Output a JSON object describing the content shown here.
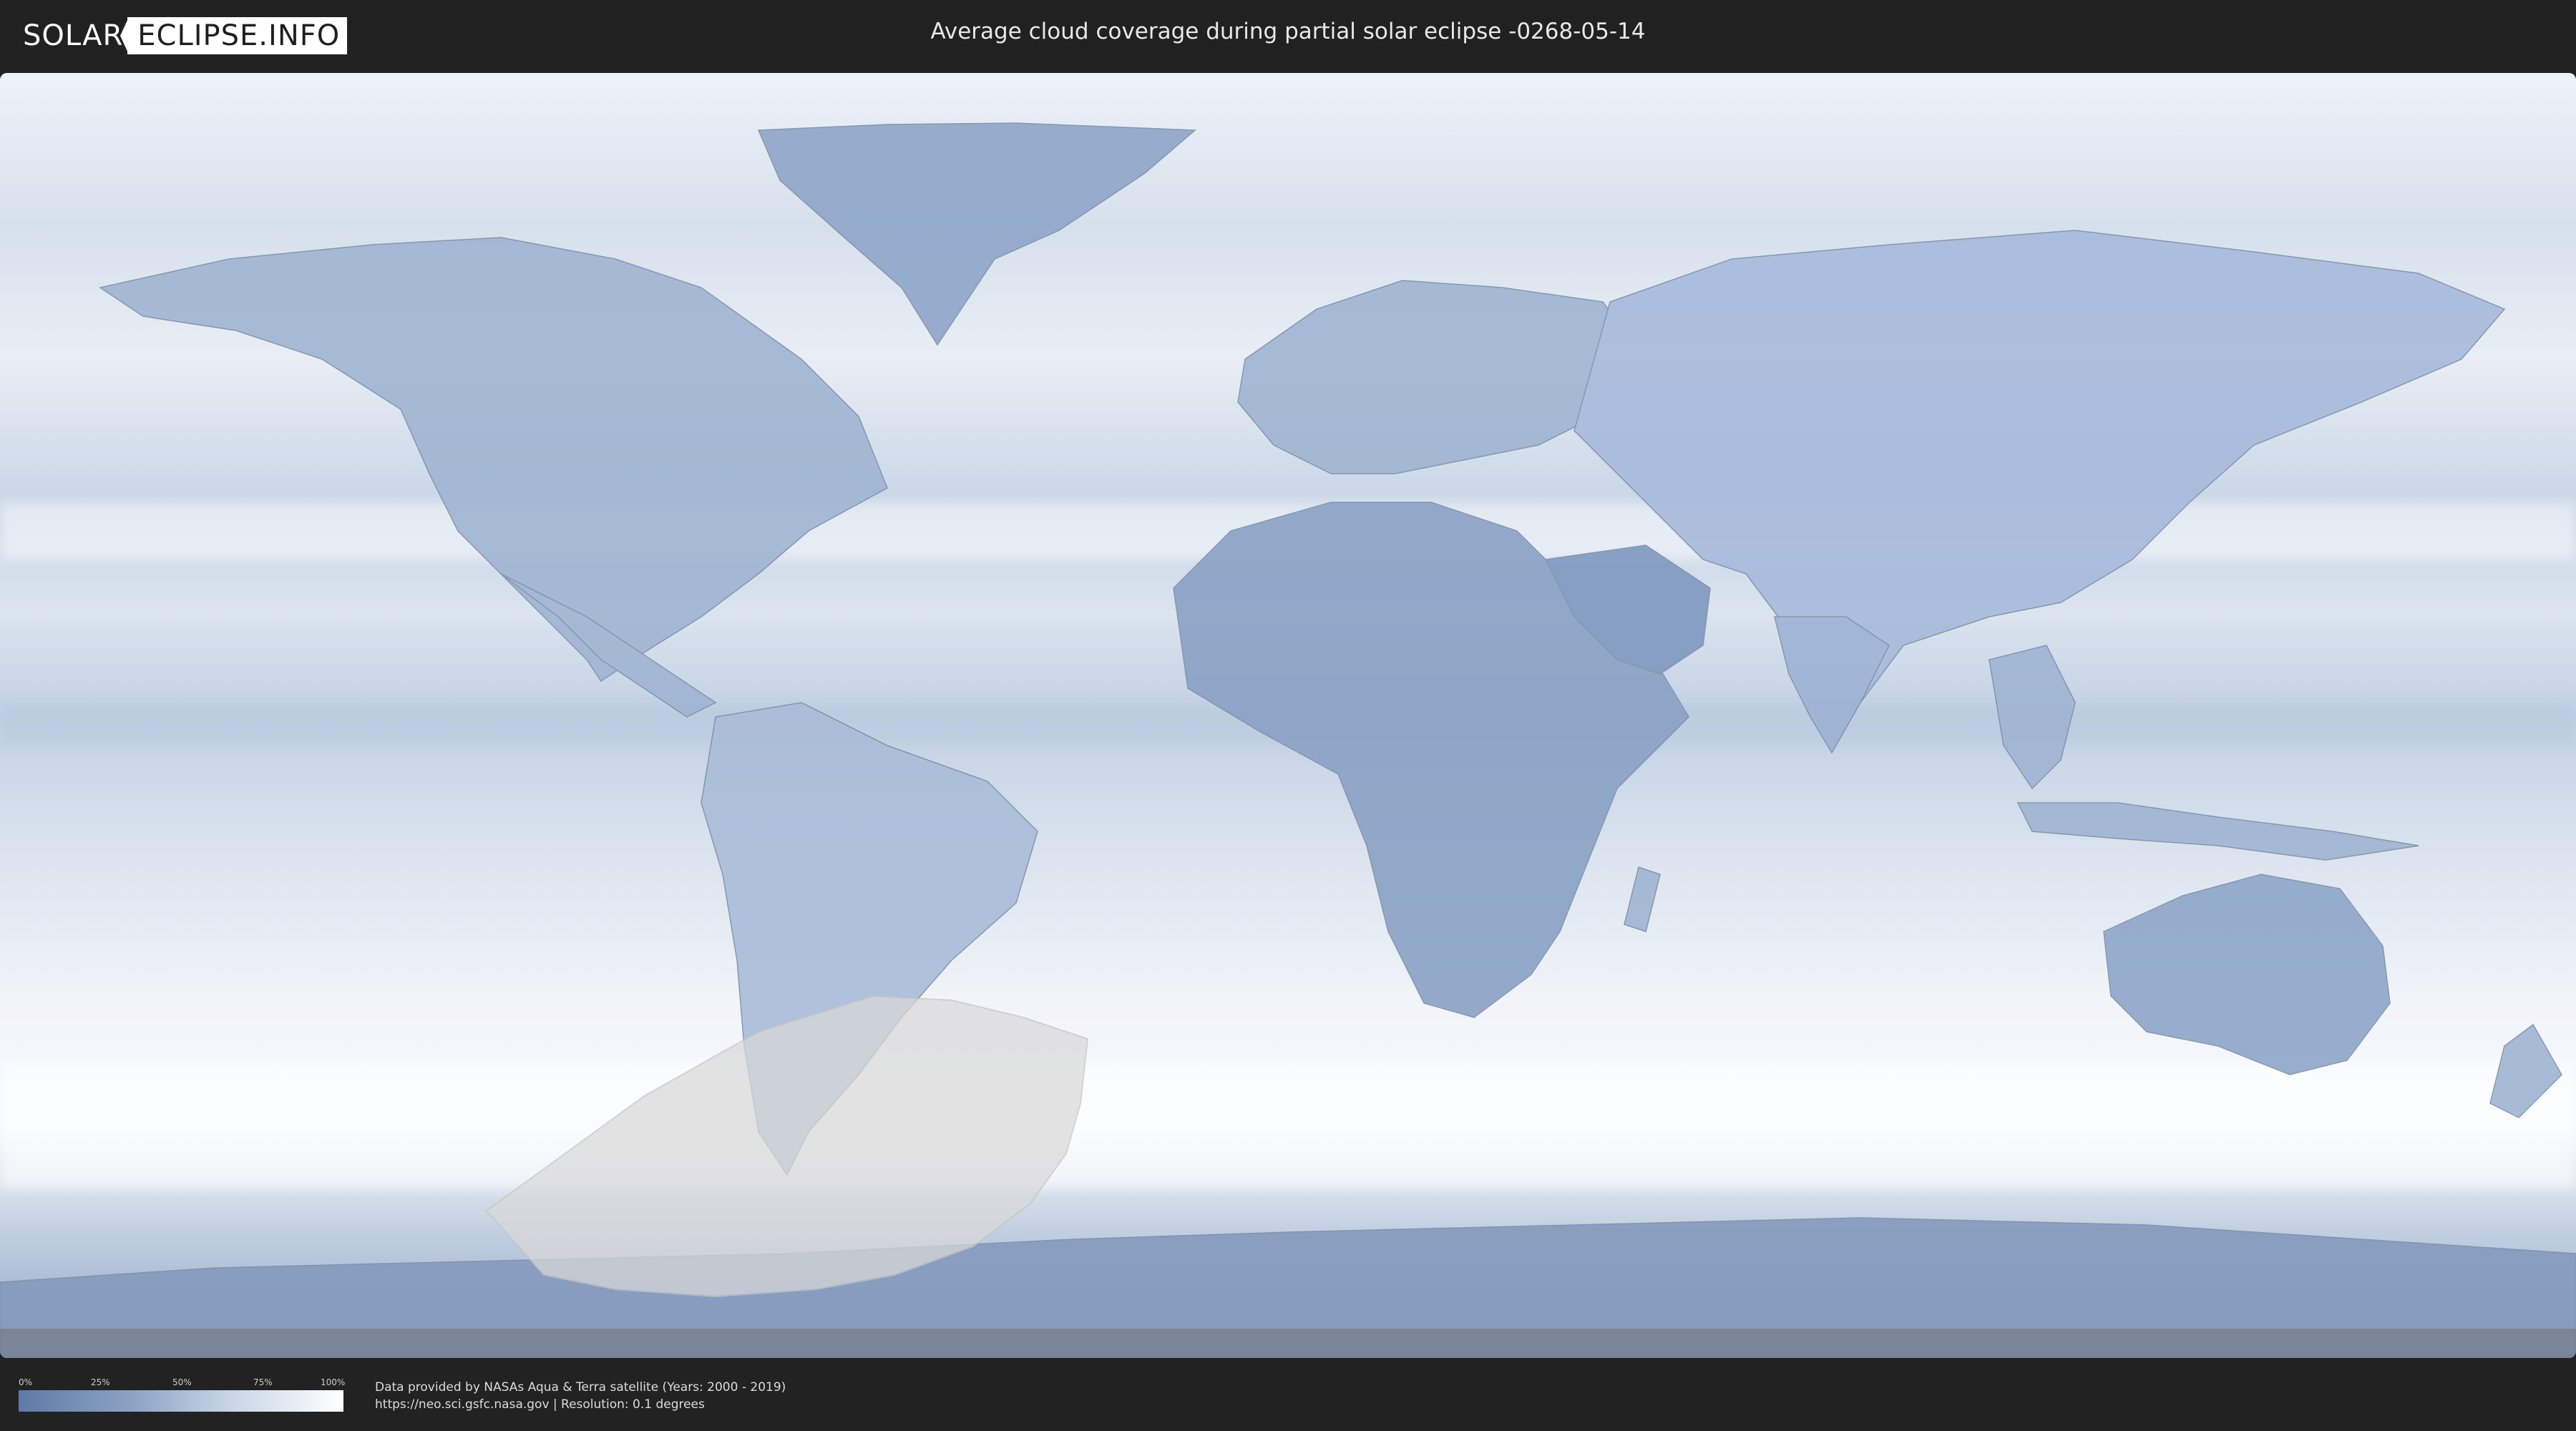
{
  "header": {
    "logo_left": "SOLAR",
    "logo_right": "ECLIPSE.INFO",
    "title": "Average cloud coverage during partial solar eclipse -0268-05-14"
  },
  "map": {
    "layers": [
      "cloud-coverage",
      "country-borders",
      "eclipse-visibility-zone"
    ],
    "colors": {
      "clear": "#5e7aa6",
      "cloudy": "#ffffff",
      "eclipse_zone": "#d9d9d9"
    }
  },
  "legend": {
    "ticks": [
      "0%",
      "25%",
      "50%",
      "75%",
      "100%"
    ],
    "values": [
      0,
      25,
      50,
      75,
      100
    ]
  },
  "footer": {
    "credit_line1": "Data provided by NASAs Aqua & Terra satellite (Years: 2000 - 2019)",
    "credit_line2": "https://neo.sci.gsfc.nasa.gov | Resolution: 0.1 degrees"
  }
}
